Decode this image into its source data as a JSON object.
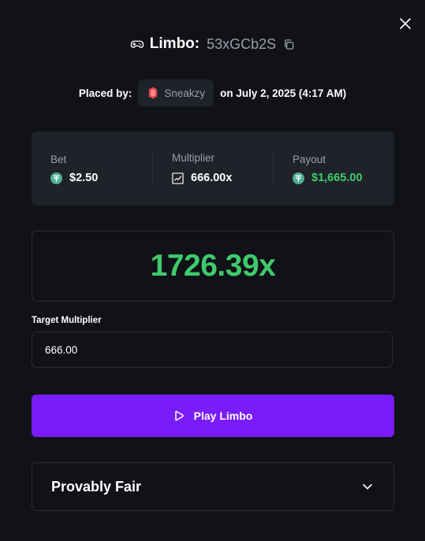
{
  "header": {
    "game_name": "Limbo:",
    "bet_id": "53xGCb2S"
  },
  "placed": {
    "prefix": "Placed by:",
    "username": "Sneakzy",
    "date_text": "on July 2, 2025 (4:17 AM)"
  },
  "stats": {
    "bet": {
      "label": "Bet",
      "value": "$2.50"
    },
    "multiplier": {
      "label": "Multiplier",
      "value": "666.00x"
    },
    "payout": {
      "label": "Payout",
      "value": "$1,665.00"
    }
  },
  "result": {
    "value": "1726.39x"
  },
  "target": {
    "label": "Target Multiplier",
    "value": "666.00"
  },
  "play_button": {
    "label": "Play Limbo"
  },
  "provably_fair": {
    "label": "Provably Fair"
  },
  "colors": {
    "background": "#101217",
    "panel": "#1f2229",
    "accent_purple": "#7a1cf9",
    "win_green": "#3fca6c",
    "muted_text": "#9a9ea8",
    "tether": "#50af95",
    "rank_gem": "#e0454d"
  },
  "icons": {
    "close": "close-icon",
    "game": "gamepad-icon",
    "copy": "copy-icon",
    "user_rank": "gem-icon",
    "currency": "tether-icon",
    "multiplier": "chart-icon",
    "play": "play-icon",
    "expand": "chevron-down-icon"
  }
}
